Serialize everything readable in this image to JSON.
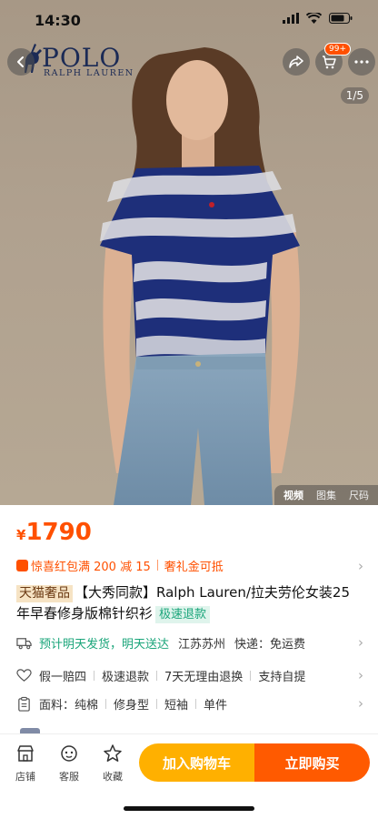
{
  "status_bar": {
    "time": "14:30"
  },
  "header": {
    "brand_main": "POLO",
    "brand_sub": "RALPH LAUREN",
    "cart_badge": "99+",
    "image_counter": "1/5"
  },
  "media_tabs": [
    "视频",
    "图集",
    "尺码"
  ],
  "price": {
    "currency": "¥",
    "value": "1790"
  },
  "promo": {
    "offer": "惊喜红包满 200 减 15",
    "gift": "奢礼金可抵"
  },
  "product": {
    "tag": "天猫奢品",
    "title": "【大秀同款】Ralph Lauren/拉夫劳伦女装25年早春修身版棉针织衫",
    "fast_refund_tag": "极速退款"
  },
  "shipping": {
    "delivery": "预计明天发货，明天送达",
    "origin": "江苏苏州",
    "fee_label": "快递：免运费"
  },
  "guarantees": [
    "假一赔四",
    "极速退款",
    "7天无理由退换",
    "支持自提"
  ],
  "attributes": [
    "面料：纯棉",
    "修身型",
    "短袖",
    "单件"
  ],
  "bottom_bar": {
    "store": "店铺",
    "service": "客服",
    "favorite": "收藏",
    "add_to_cart": "加入购物车",
    "buy_now": "立即购买"
  },
  "colors": {
    "accent": "#ff5000",
    "cart_button": "#ffb000",
    "buy_button": "#ff5a00",
    "green": "#1aa57a"
  }
}
